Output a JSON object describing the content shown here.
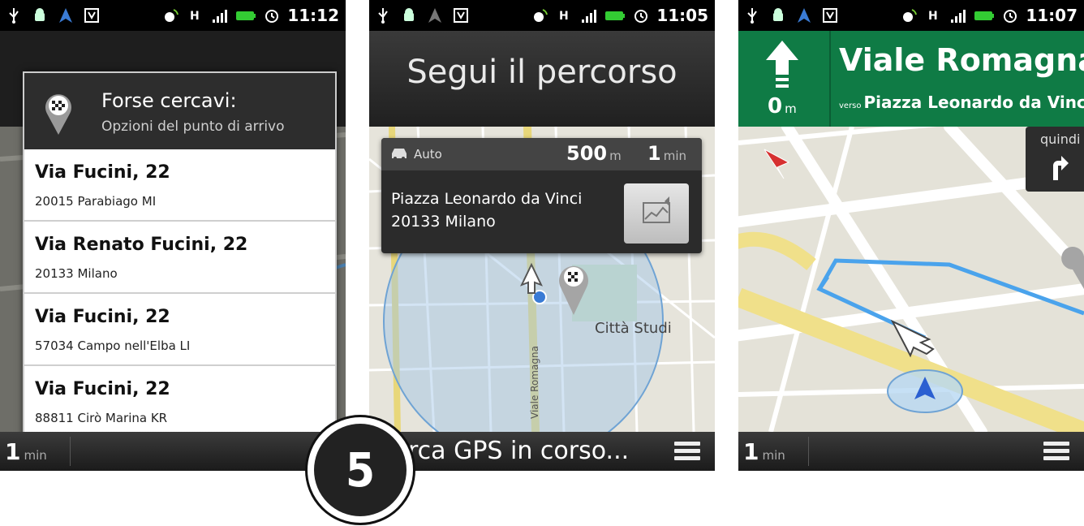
{
  "status": {
    "time_1": "11:12",
    "time_2": "11:05",
    "time_3": "11:07"
  },
  "screen1": {
    "dialog": {
      "title": "Forse cercavi:",
      "subtitle": "Opzioni del punto di arrivo"
    },
    "results": [
      {
        "name": "Via Fucini, 22",
        "address": "20015 Parabiago MI"
      },
      {
        "name": "Via Renato Fucini, 22",
        "address": "20133 Milano"
      },
      {
        "name": "Via Fucini, 22",
        "address": "57034 Campo nell'Elba LI"
      },
      {
        "name": "Via Fucini, 22",
        "address": "88811 Cirò Marina KR"
      }
    ],
    "bottom": {
      "time_value": "1",
      "time_unit": "min"
    }
  },
  "screen2": {
    "title": "Segui il percorso",
    "card": {
      "mode": "Auto",
      "distance_value": "500",
      "distance_unit": "m",
      "duration_value": "1",
      "duration_unit": "min",
      "address_line1": "Piazza Leonardo da Vinci",
      "address_line2": "20133 Milano"
    },
    "map_labels": {
      "district": "Città Studi",
      "street": "Viale Romagna"
    },
    "bottom": {
      "status": "rca GPS in corso..."
    }
  },
  "screen3": {
    "street": "Viale Romagna",
    "verso_prefix": "verso",
    "verso_target": "Piazza Leonardo da Vinci",
    "distance_value": "0",
    "distance_unit": "m",
    "then_label": "quindi",
    "bottom": {
      "time_value": "1",
      "time_unit": "min"
    }
  },
  "step_badge": "5",
  "colors": {
    "nav_green": "#0f7b45",
    "route_blue": "#3aa0e8",
    "status_bar": "#000000"
  },
  "icons": [
    "usb-icon",
    "android-icon",
    "navigation-icon",
    "shield-icon",
    "gps-icon",
    "hspa-icon",
    "signal-icon",
    "battery-icon",
    "alarm-icon",
    "menu-icon",
    "destination-pin-icon",
    "car-icon",
    "map-icon",
    "arrow-up-icon",
    "turn-right-icon"
  ]
}
